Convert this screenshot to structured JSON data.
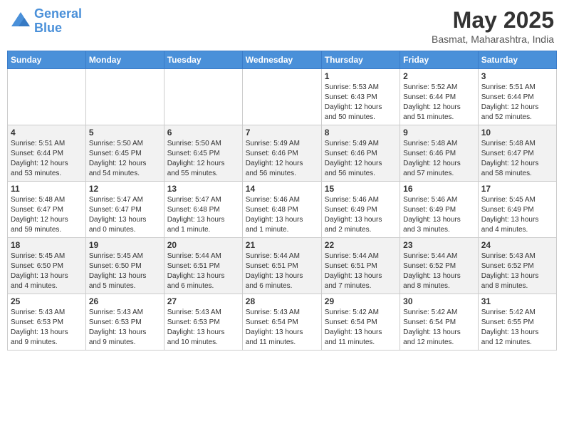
{
  "header": {
    "logo_line1": "General",
    "logo_line2": "Blue",
    "month": "May 2025",
    "location": "Basmat, Maharashtra, India"
  },
  "weekdays": [
    "Sunday",
    "Monday",
    "Tuesday",
    "Wednesday",
    "Thursday",
    "Friday",
    "Saturday"
  ],
  "weeks": [
    [
      {
        "day": "",
        "info": ""
      },
      {
        "day": "",
        "info": ""
      },
      {
        "day": "",
        "info": ""
      },
      {
        "day": "",
        "info": ""
      },
      {
        "day": "1",
        "info": "Sunrise: 5:53 AM\nSunset: 6:43 PM\nDaylight: 12 hours\nand 50 minutes."
      },
      {
        "day": "2",
        "info": "Sunrise: 5:52 AM\nSunset: 6:44 PM\nDaylight: 12 hours\nand 51 minutes."
      },
      {
        "day": "3",
        "info": "Sunrise: 5:51 AM\nSunset: 6:44 PM\nDaylight: 12 hours\nand 52 minutes."
      }
    ],
    [
      {
        "day": "4",
        "info": "Sunrise: 5:51 AM\nSunset: 6:44 PM\nDaylight: 12 hours\nand 53 minutes."
      },
      {
        "day": "5",
        "info": "Sunrise: 5:50 AM\nSunset: 6:45 PM\nDaylight: 12 hours\nand 54 minutes."
      },
      {
        "day": "6",
        "info": "Sunrise: 5:50 AM\nSunset: 6:45 PM\nDaylight: 12 hours\nand 55 minutes."
      },
      {
        "day": "7",
        "info": "Sunrise: 5:49 AM\nSunset: 6:46 PM\nDaylight: 12 hours\nand 56 minutes."
      },
      {
        "day": "8",
        "info": "Sunrise: 5:49 AM\nSunset: 6:46 PM\nDaylight: 12 hours\nand 56 minutes."
      },
      {
        "day": "9",
        "info": "Sunrise: 5:48 AM\nSunset: 6:46 PM\nDaylight: 12 hours\nand 57 minutes."
      },
      {
        "day": "10",
        "info": "Sunrise: 5:48 AM\nSunset: 6:47 PM\nDaylight: 12 hours\nand 58 minutes."
      }
    ],
    [
      {
        "day": "11",
        "info": "Sunrise: 5:48 AM\nSunset: 6:47 PM\nDaylight: 12 hours\nand 59 minutes."
      },
      {
        "day": "12",
        "info": "Sunrise: 5:47 AM\nSunset: 6:47 PM\nDaylight: 13 hours\nand 0 minutes."
      },
      {
        "day": "13",
        "info": "Sunrise: 5:47 AM\nSunset: 6:48 PM\nDaylight: 13 hours\nand 1 minute."
      },
      {
        "day": "14",
        "info": "Sunrise: 5:46 AM\nSunset: 6:48 PM\nDaylight: 13 hours\nand 1 minute."
      },
      {
        "day": "15",
        "info": "Sunrise: 5:46 AM\nSunset: 6:49 PM\nDaylight: 13 hours\nand 2 minutes."
      },
      {
        "day": "16",
        "info": "Sunrise: 5:46 AM\nSunset: 6:49 PM\nDaylight: 13 hours\nand 3 minutes."
      },
      {
        "day": "17",
        "info": "Sunrise: 5:45 AM\nSunset: 6:49 PM\nDaylight: 13 hours\nand 4 minutes."
      }
    ],
    [
      {
        "day": "18",
        "info": "Sunrise: 5:45 AM\nSunset: 6:50 PM\nDaylight: 13 hours\nand 4 minutes."
      },
      {
        "day": "19",
        "info": "Sunrise: 5:45 AM\nSunset: 6:50 PM\nDaylight: 13 hours\nand 5 minutes."
      },
      {
        "day": "20",
        "info": "Sunrise: 5:44 AM\nSunset: 6:51 PM\nDaylight: 13 hours\nand 6 minutes."
      },
      {
        "day": "21",
        "info": "Sunrise: 5:44 AM\nSunset: 6:51 PM\nDaylight: 13 hours\nand 6 minutes."
      },
      {
        "day": "22",
        "info": "Sunrise: 5:44 AM\nSunset: 6:51 PM\nDaylight: 13 hours\nand 7 minutes."
      },
      {
        "day": "23",
        "info": "Sunrise: 5:44 AM\nSunset: 6:52 PM\nDaylight: 13 hours\nand 8 minutes."
      },
      {
        "day": "24",
        "info": "Sunrise: 5:43 AM\nSunset: 6:52 PM\nDaylight: 13 hours\nand 8 minutes."
      }
    ],
    [
      {
        "day": "25",
        "info": "Sunrise: 5:43 AM\nSunset: 6:53 PM\nDaylight: 13 hours\nand 9 minutes."
      },
      {
        "day": "26",
        "info": "Sunrise: 5:43 AM\nSunset: 6:53 PM\nDaylight: 13 hours\nand 9 minutes."
      },
      {
        "day": "27",
        "info": "Sunrise: 5:43 AM\nSunset: 6:53 PM\nDaylight: 13 hours\nand 10 minutes."
      },
      {
        "day": "28",
        "info": "Sunrise: 5:43 AM\nSunset: 6:54 PM\nDaylight: 13 hours\nand 11 minutes."
      },
      {
        "day": "29",
        "info": "Sunrise: 5:42 AM\nSunset: 6:54 PM\nDaylight: 13 hours\nand 11 minutes."
      },
      {
        "day": "30",
        "info": "Sunrise: 5:42 AM\nSunset: 6:54 PM\nDaylight: 13 hours\nand 12 minutes."
      },
      {
        "day": "31",
        "info": "Sunrise: 5:42 AM\nSunset: 6:55 PM\nDaylight: 13 hours\nand 12 minutes."
      }
    ]
  ]
}
